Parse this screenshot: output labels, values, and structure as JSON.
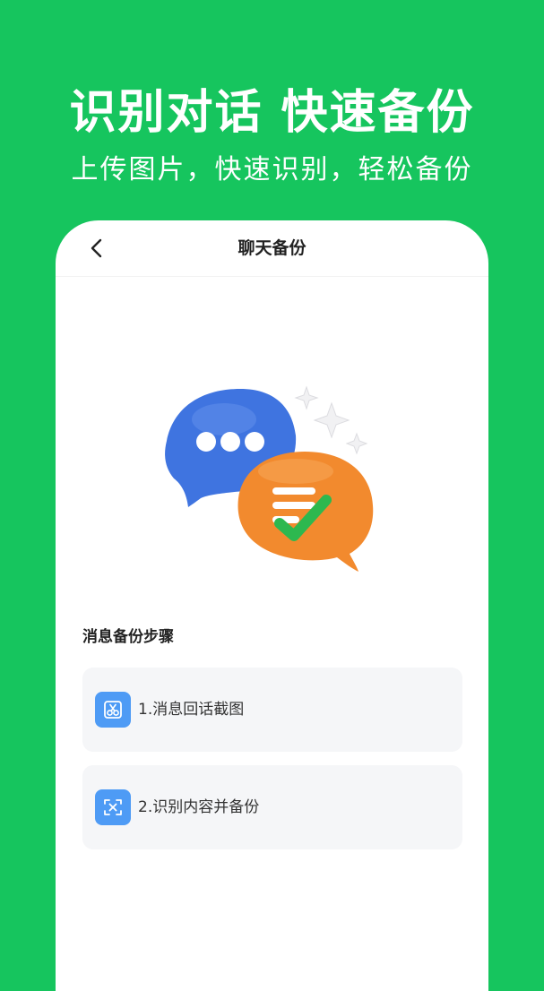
{
  "hero": {
    "title": "识别对话 快速备份",
    "subtitle": "上传图片，快速识别，轻松备份"
  },
  "nav": {
    "title": "聊天备份",
    "back_icon": "chevron-left-icon"
  },
  "illustration": {
    "description_icons": [
      "chat-bubble-icon",
      "check-bubble-icon",
      "sparkle-icon"
    ],
    "colors": {
      "blue": "#3F74E0",
      "orange": "#F28A2E",
      "check": "#2DB84F"
    }
  },
  "steps_section": {
    "title": "消息备份步骤",
    "steps": [
      {
        "label": "1.消息回话截图",
        "icon": "screenshot-scissors-icon"
      },
      {
        "label": "2.识别内容并备份",
        "icon": "text-scan-icon"
      }
    ]
  },
  "colors": {
    "background": "#16C55E",
    "card": "#FFFFFF",
    "step_bg": "#F5F6F8",
    "step_icon": "#4E9BF5"
  }
}
